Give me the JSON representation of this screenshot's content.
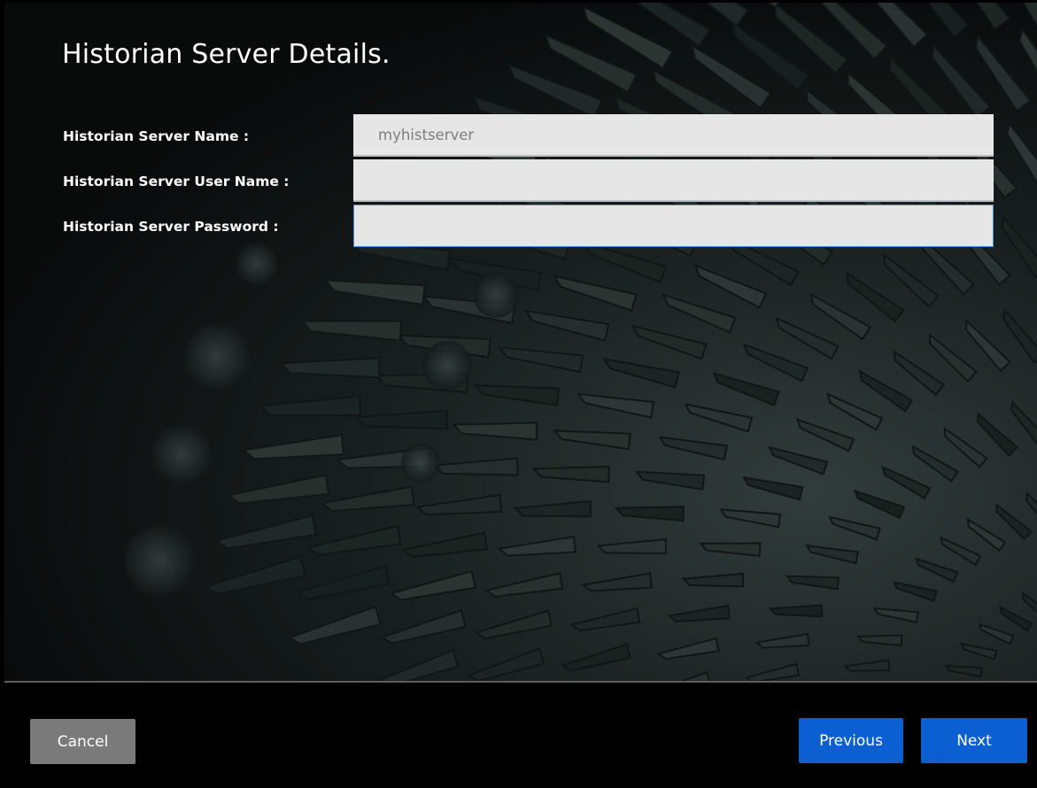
{
  "title": "Historian Server Details.",
  "fields": [
    {
      "label": "Historian Server Name :",
      "value": "myhistserver",
      "placeholder": ""
    },
    {
      "label": "Historian Server User Name :",
      "value": "",
      "placeholder": ""
    },
    {
      "label": "Historian Server Password :",
      "value": "",
      "placeholder": ""
    }
  ],
  "buttons": {
    "cancel": "Cancel",
    "previous": "Previous",
    "next": "Next"
  },
  "colors": {
    "primary_button": "#0b5fd0",
    "secondary_button": "#7a7a7a",
    "input_background": "#e6e6e6",
    "focus_border": "#3b8fe0",
    "background": "#000000"
  },
  "background_image": "turbine-blades-image"
}
